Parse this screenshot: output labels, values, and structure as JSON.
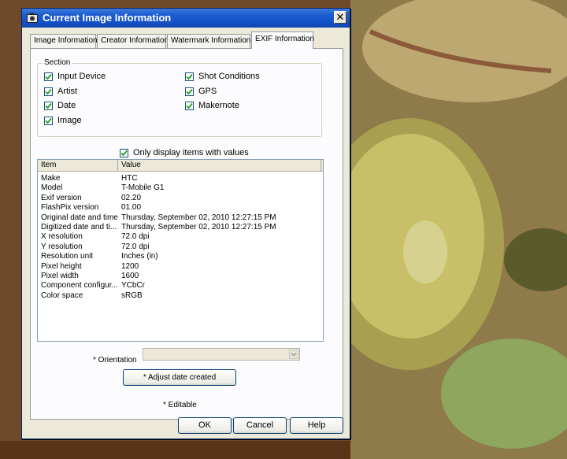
{
  "window": {
    "title": "Current Image Information",
    "close_glyph": "✕"
  },
  "tabs": [
    {
      "label": "Image Information",
      "active": false
    },
    {
      "label": "Creator Information",
      "active": false
    },
    {
      "label": "Watermark Information",
      "active": false
    },
    {
      "label": "EXIF Information",
      "active": true
    }
  ],
  "section": {
    "legend": "Section",
    "checkboxes": [
      {
        "label": "Input Device",
        "checked": true
      },
      {
        "label": "Artist",
        "checked": true
      },
      {
        "label": "Date",
        "checked": true
      },
      {
        "label": "Image",
        "checked": true
      },
      {
        "label": "Shot Conditions",
        "checked": true
      },
      {
        "label": "GPS",
        "checked": true
      },
      {
        "label": "Makernote",
        "checked": true
      }
    ]
  },
  "filter": {
    "label": "Only display items with values",
    "checked": true
  },
  "table": {
    "columns": [
      "Item",
      "Value"
    ],
    "rows": [
      [
        "Make",
        "HTC"
      ],
      [
        "Model",
        "T-Mobile G1"
      ],
      [
        "Exif version",
        "02.20"
      ],
      [
        "FlashPix version",
        "01.00"
      ],
      [
        "Original date and time",
        "Thursday, September 02, 2010 12:27:15 PM"
      ],
      [
        "Digitized date and ti...",
        "Thursday, September 02, 2010 12:27:15 PM"
      ],
      [
        "X resolution",
        "72.0 dpi"
      ],
      [
        "Y resolution",
        "72.0 dpi"
      ],
      [
        "Resolution unit",
        "Inches (in)"
      ],
      [
        "Pixel height",
        "1200"
      ],
      [
        "Pixel width",
        "1600"
      ],
      [
        "Component configur...",
        "YCbCr"
      ],
      [
        "Color space",
        "sRGB"
      ]
    ]
  },
  "orientation": {
    "label": "* Orientation",
    "value": ""
  },
  "adjust_button": "* Adjust date created",
  "editable_note": "* Editable",
  "buttons": {
    "ok": "OK",
    "cancel": "Cancel",
    "help": "Help"
  },
  "colors": {
    "title_bar": "#1552c9",
    "dialog_bg": "#ece9d8",
    "panel_bg": "#fcfcfe",
    "check_green": "#21a121"
  }
}
